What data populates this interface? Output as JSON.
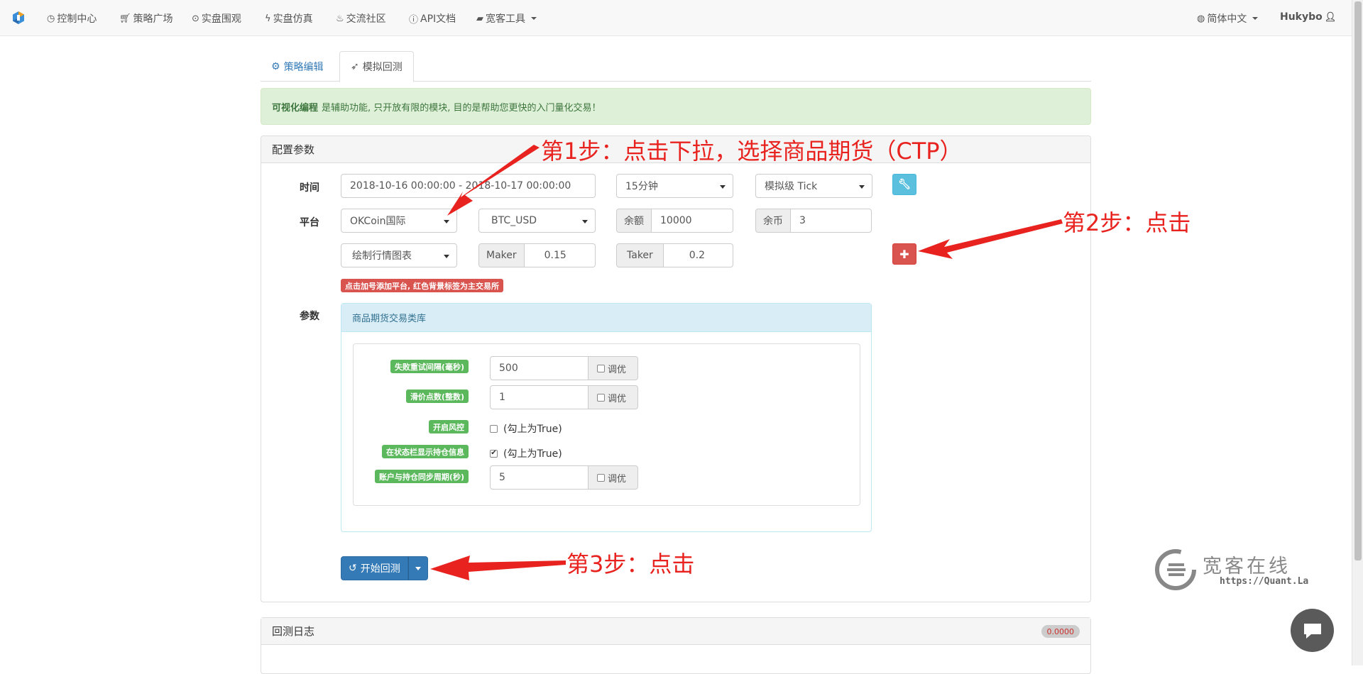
{
  "nav": {
    "items": [
      {
        "icon": "clock-icon",
        "label": "控制中心"
      },
      {
        "icon": "cart-icon",
        "label": "策略广场"
      },
      {
        "icon": "play-circle-icon",
        "label": "实盘围观"
      },
      {
        "icon": "bolt-icon",
        "label": "实盘仿真"
      },
      {
        "icon": "fire-icon",
        "label": "交流社区"
      },
      {
        "icon": "info-icon",
        "label": "API文档"
      },
      {
        "icon": "briefcase-icon",
        "label": "宽客工具"
      }
    ],
    "language": "简体中文",
    "user": "Hukybo"
  },
  "tabs": [
    {
      "label": "策略编辑",
      "icon": "cogs-icon"
    },
    {
      "label": "模拟回测",
      "icon": "rocket-icon"
    }
  ],
  "alert": {
    "bold": "可视化编程",
    "text": "是辅助功能, 只开放有限的模块, 目的是帮助您更快的入门量化交易！"
  },
  "config": {
    "title": "配置参数",
    "time_label": "时间",
    "time_range": "2018-10-16 00:00:00 - 2018-10-17 00:00:00",
    "period": "15分钟",
    "tick_mode": "模拟级 Tick",
    "platform_label": "平台",
    "exchange": "OKCoin国际",
    "pair": "BTC_USD",
    "balance_label": "余额",
    "balance": "10000",
    "coins_label": "余币",
    "coins": "3",
    "chart_mode": "绘制行情图表",
    "maker_label": "Maker",
    "maker": "0.15",
    "taker_label": "Taker",
    "taker": "0.2",
    "hint": "点击加号添加平台, 红色背景标签为主交易所",
    "params_label": "参数"
  },
  "library": {
    "title": "商品期货交易类库",
    "tune_label": "调优",
    "params": [
      {
        "label": "失败重试间隔(毫秒)",
        "value": "500",
        "type": "input"
      },
      {
        "label": "滑价点数(整数)",
        "value": "1",
        "type": "input"
      },
      {
        "label": "开启风控",
        "value": "(勾上为True)",
        "type": "check",
        "checked": false
      },
      {
        "label": "在状态栏显示持仓信息",
        "value": "(勾上为True)",
        "type": "check",
        "checked": true
      },
      {
        "label": "账户与持仓同步周期(秒)",
        "value": "5",
        "type": "input"
      }
    ]
  },
  "start_button": "开始回测",
  "log": {
    "title": "回测日志",
    "badge": "0.0000"
  },
  "annotations": {
    "step1": "第1步：点击下拉，选择商品期货（CTP）",
    "step2": "第2步：点击",
    "step3": "第3步：点击"
  },
  "watermark": {
    "title": "宽客在线",
    "url": "https://Quant.La"
  },
  "colors": {
    "accent": "#337ab7",
    "danger": "#d9534f",
    "success": "#5cb85c",
    "annotation": "#e8231f"
  }
}
